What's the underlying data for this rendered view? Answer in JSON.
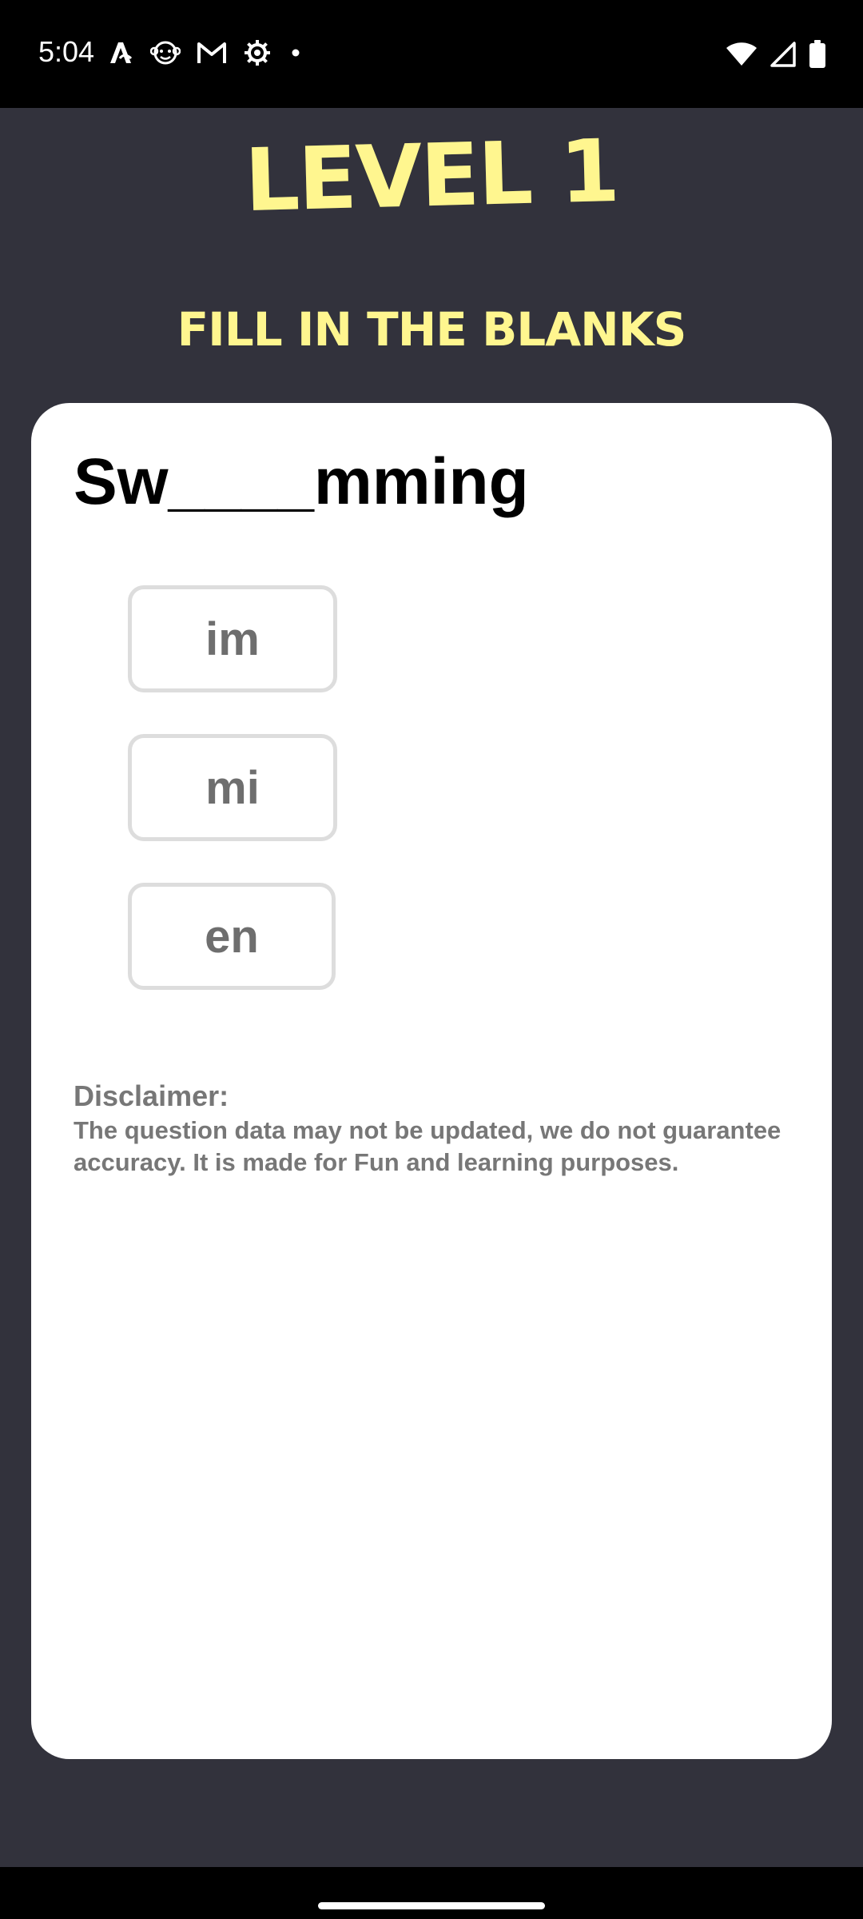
{
  "status_bar": {
    "time": "5:04",
    "left_icons": [
      "font-app-icon",
      "monkey-app-icon",
      "gmail-icon",
      "settings-gear-icon",
      "notification-dot-icon"
    ],
    "right_icons": [
      "wifi-icon",
      "cell-signal-icon",
      "battery-icon"
    ]
  },
  "header": {
    "level_title": "LEVEL 1",
    "subtitle": "FILL IN THE BLANKS"
  },
  "question": {
    "text": "Sw____mming"
  },
  "options": [
    {
      "label": "im"
    },
    {
      "label": "mi"
    },
    {
      "label": "en"
    }
  ],
  "disclaimer": {
    "title": "Disclaimer:",
    "text": "The question data may not be updated, we do not guarantee accuracy. It is made for Fun and learning purposes."
  },
  "colors": {
    "background": "#32323c",
    "title_yellow": "#fff68f",
    "card": "#ffffff",
    "option_border": "#dddddd",
    "muted_text": "#777777"
  }
}
